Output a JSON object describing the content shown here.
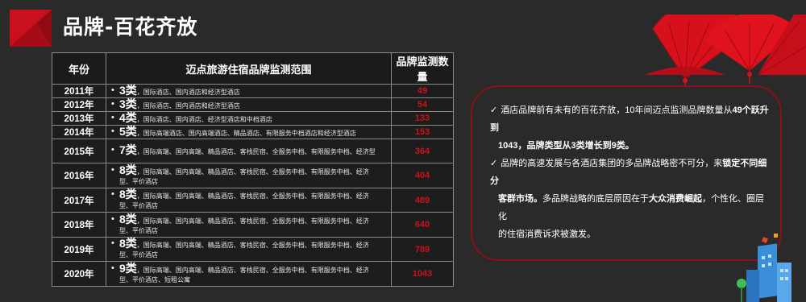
{
  "page": {
    "title": "品牌-百花齐放"
  },
  "table": {
    "headers": [
      "年份",
      "迈点旅游住宿品牌监测范围",
      "品牌监测数量"
    ],
    "rows": [
      {
        "year": "2011年",
        "types": "3类",
        "desc": "，国际酒店、国内酒店和经济型酒店",
        "count": "49"
      },
      {
        "year": "2012年",
        "types": "3类",
        "desc": "，国际酒店、国内酒店和经济型酒店",
        "count": "54"
      },
      {
        "year": "2013年",
        "types": "4类",
        "desc": "，国际酒店、国内酒店、经济型酒店和中档酒店",
        "count": "133"
      },
      {
        "year": "2014年",
        "types": "5类",
        "desc": "，国际高端酒店、国内高端酒店、精品酒店、有限服务中档酒店和经济型酒店",
        "count": "153"
      },
      {
        "year": "2015年",
        "types": "7类",
        "desc": "，国际高端、国内高端、精品酒店、客栈民宿、全服务中档、有限服务中档、经济型",
        "count": "364"
      },
      {
        "year": "2016年",
        "types": "8类",
        "desc": "，国际高端、国内高端、精品酒店、客栈民宿、全服务中档、有限服务中档、经济型、平价酒店",
        "count": "404"
      },
      {
        "year": "2017年",
        "types": "8类",
        "desc": "，国际高端、国内高端、精品酒店、客栈民宿、全服务中档、有限服务中档、经济型、平价酒店",
        "count": "489"
      },
      {
        "year": "2018年",
        "types": "8类",
        "desc": "，国际高端、国内高端、精品酒店、客栈民宿、全服务中档、有限服务中档、经济型、平价酒店",
        "count": "640"
      },
      {
        "year": "2019年",
        "types": "8类",
        "desc": "，国际高端、国内高端、精品酒店、客栈民宿、全服务中档、有限服务中档、经济型、平价酒店",
        "count": "789"
      },
      {
        "year": "2020年",
        "types": "9类",
        "desc": "，国际高端、国内高端、精品酒店、客栈民宿、全服务中档、有限服务中档、经济型、平价酒店、短租公寓",
        "count": "1043"
      }
    ]
  },
  "info": {
    "p1_line1_a": "酒店品牌前有未有的百花齐放，10年间迈点监测品牌数量从",
    "p1_line1_b": "49个跃升到",
    "p1_line2": "1043，品牌类型从3类增长到9类。",
    "p2_line1_a": "品牌的高速发展与各酒店集团的多品牌战略密不可分，来",
    "p2_line1_b": "锁定不同细分",
    "p2_line2_a": "客群市场。",
    "p2_line2_b": "多品牌战略的底层原因在于",
    "p2_line2_c": "大众消费崛起",
    "p2_line2_d": "，个性化、圈层化",
    "p2_line3": "的住宿消费诉求被激发。",
    "check_glyph": "✓"
  },
  "colors": {
    "accent": "#c8101e",
    "count_red": "#d0101a",
    "background": "#2a2a2a"
  }
}
